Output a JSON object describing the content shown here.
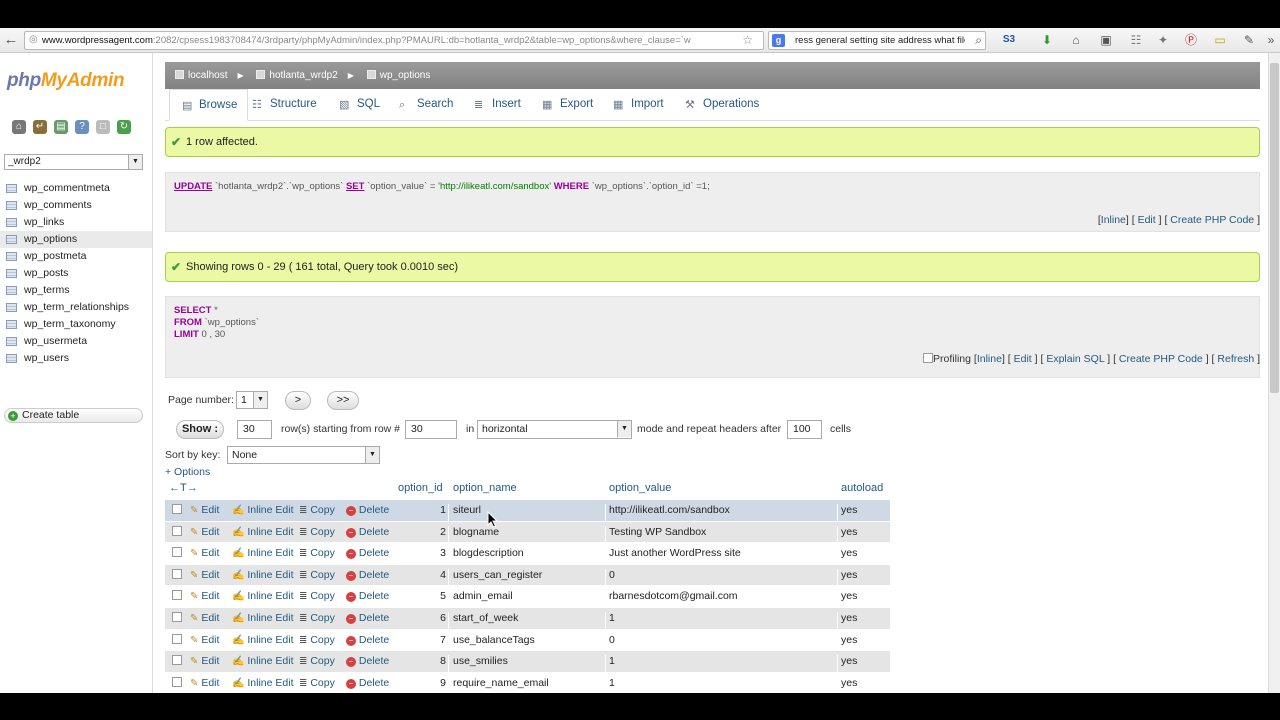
{
  "browser": {
    "url_host": "www.wordpressagent.com",
    "url_rest": ":2082/cpsess1983708474/3rdparty/phpMyAdmin/index.php?PMAURL:db=hotlanta_wrdp2&table=wp_options&where_clause=`w",
    "search_query": "ress general setting site address what file",
    "search_engine": "g"
  },
  "sidebar": {
    "logo_php": "php",
    "logo_myadmin": "MyAdmin",
    "db_select": "_wrdp2",
    "tables": [
      "wp_commentmeta",
      "wp_comments",
      "wp_links",
      "wp_options",
      "wp_postmeta",
      "wp_posts",
      "wp_terms",
      "wp_term_relationships",
      "wp_term_taxonomy",
      "wp_usermeta",
      "wp_users"
    ],
    "active_table": "wp_options",
    "create_table": "Create table"
  },
  "breadcrumb": {
    "server": "localhost",
    "database": "hotlanta_wrdp2",
    "table": "wp_options"
  },
  "tabs": [
    "Browse",
    "Structure",
    "SQL",
    "Search",
    "Insert",
    "Export",
    "Import",
    "Operations"
  ],
  "update_notice": "1 row affected.",
  "update_sql": {
    "kw1": "UPDATE",
    "p1": " `hotlanta_wrdp2`.`wp_options` ",
    "kw2": "SET",
    "p2": " `option_value` = ",
    "val": "'http://ilikeatl.com/sandbox'",
    "kw3": " WHERE",
    "p3": " `wp_options`.`option_id` =1;"
  },
  "update_links": {
    "inline": "Inline",
    "edit": "Edit",
    "php": "Create PHP Code"
  },
  "rows_notice": "Showing rows 0 - 29 ( 161 total, Query took 0.0010 sec)",
  "select_sql": {
    "l1_kw": "SELECT",
    "l1": " *",
    "l2_kw": "FROM",
    "l2": " `wp_options`",
    "l3_kw": "LIMIT",
    "l3": " 0 , 30"
  },
  "select_links": {
    "profiling": "Profiling",
    "inline": "Inline",
    "edit": "Edit",
    "explain": "Explain SQL",
    "php": "Create PHP Code",
    "refresh": "Refresh"
  },
  "nav": {
    "page_label": "Page number:",
    "page_value": "1",
    "next": ">",
    "last": ">>",
    "show": "Show :",
    "rows_value": "30",
    "rows_label": "row(s) starting from row #",
    "start_value": "30",
    "in_label": "in",
    "mode_value": "horizontal",
    "mode_label": "mode and repeat headers after",
    "repeat_value": "100",
    "cells_label": "cells",
    "sort_label": "Sort by key:",
    "sort_value": "None",
    "options": "+ Options"
  },
  "columns": {
    "arrows": "←T→",
    "id": "option_id",
    "name": "option_name",
    "value": "option_value",
    "autoload": "autoload"
  },
  "actions": {
    "edit": "Edit",
    "inline": "Inline Edit",
    "copy": "Copy",
    "delete": "Delete"
  },
  "rows": [
    {
      "id": "1",
      "name": "siteurl",
      "value": "http://ilikeatl.com/sandbox",
      "autoload": "yes"
    },
    {
      "id": "2",
      "name": "blogname",
      "value": "Testing WP Sandbox",
      "autoload": "yes"
    },
    {
      "id": "3",
      "name": "blogdescription",
      "value": "Just another WordPress site",
      "autoload": "yes"
    },
    {
      "id": "4",
      "name": "users_can_register",
      "value": "0",
      "autoload": "yes"
    },
    {
      "id": "5",
      "name": "admin_email",
      "value": "rbarnesdotcom@gmail.com",
      "autoload": "yes"
    },
    {
      "id": "6",
      "name": "start_of_week",
      "value": "1",
      "autoload": "yes"
    },
    {
      "id": "7",
      "name": "use_balanceTags",
      "value": "0",
      "autoload": "yes"
    },
    {
      "id": "8",
      "name": "use_smilies",
      "value": "1",
      "autoload": "yes"
    },
    {
      "id": "9",
      "name": "require_name_email",
      "value": "1",
      "autoload": "yes"
    }
  ]
}
